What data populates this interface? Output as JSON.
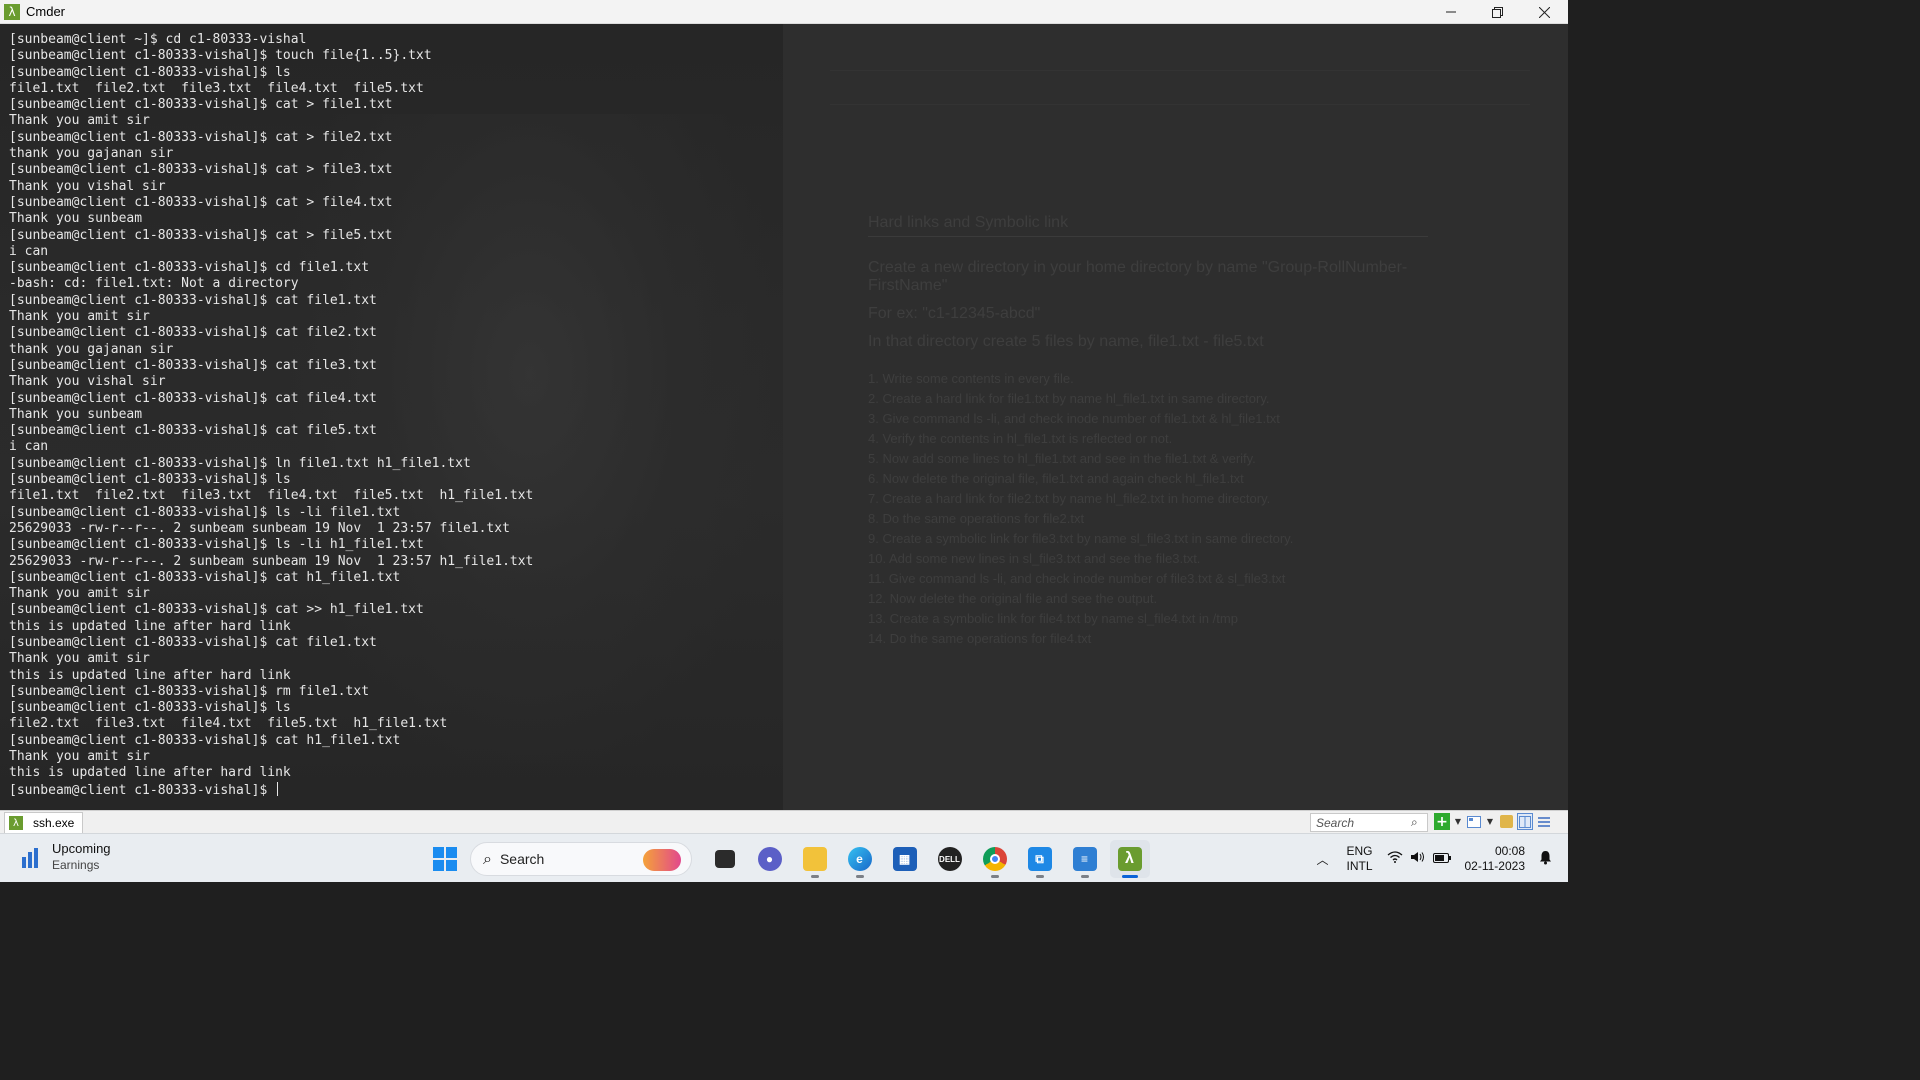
{
  "window": {
    "title": "Cmder",
    "icon": "lambda-icon"
  },
  "terminal": {
    "lines": [
      "[sunbeam@client ~]$ cd c1-80333-vishal",
      "[sunbeam@client c1-80333-vishal]$ touch file{1..5}.txt",
      "[sunbeam@client c1-80333-vishal]$ ls",
      "file1.txt  file2.txt  file3.txt  file4.txt  file5.txt",
      "[sunbeam@client c1-80333-vishal]$ cat > file1.txt",
      "Thank you amit sir",
      "[sunbeam@client c1-80333-vishal]$ cat > file2.txt",
      "thank you gajanan sir",
      "[sunbeam@client c1-80333-vishal]$ cat > file3.txt",
      "Thank you vishal sir",
      "[sunbeam@client c1-80333-vishal]$ cat > file4.txt",
      "Thank you sunbeam",
      "[sunbeam@client c1-80333-vishal]$ cat > file5.txt",
      "i can",
      "[sunbeam@client c1-80333-vishal]$ cd file1.txt",
      "-bash: cd: file1.txt: Not a directory",
      "[sunbeam@client c1-80333-vishal]$ cat file1.txt",
      "Thank you amit sir",
      "[sunbeam@client c1-80333-vishal]$ cat file2.txt",
      "thank you gajanan sir",
      "[sunbeam@client c1-80333-vishal]$ cat file3.txt",
      "Thank you vishal sir",
      "[sunbeam@client c1-80333-vishal]$ cat file4.txt",
      "Thank you sunbeam",
      "[sunbeam@client c1-80333-vishal]$ cat file5.txt",
      "i can",
      "[sunbeam@client c1-80333-vishal]$ ln file1.txt h1_file1.txt",
      "[sunbeam@client c1-80333-vishal]$ ls",
      "file1.txt  file2.txt  file3.txt  file4.txt  file5.txt  h1_file1.txt",
      "[sunbeam@client c1-80333-vishal]$ ls -li file1.txt",
      "25629033 -rw-r--r--. 2 sunbeam sunbeam 19 Nov  1 23:57 file1.txt",
      "[sunbeam@client c1-80333-vishal]$ ls -li h1_file1.txt",
      "25629033 -rw-r--r--. 2 sunbeam sunbeam 19 Nov  1 23:57 h1_file1.txt",
      "[sunbeam@client c1-80333-vishal]$ cat h1_file1.txt",
      "Thank you amit sir",
      "[sunbeam@client c1-80333-vishal]$ cat >> h1_file1.txt",
      "this is updated line after hard link",
      "[sunbeam@client c1-80333-vishal]$ cat file1.txt",
      "Thank you amit sir",
      "this is updated line after hard link",
      "[sunbeam@client c1-80333-vishal]$ rm file1.txt",
      "[sunbeam@client c1-80333-vishal]$ ls",
      "file2.txt  file3.txt  file4.txt  file5.txt  h1_file1.txt",
      "[sunbeam@client c1-80333-vishal]$ cat h1_file1.txt",
      "Thank you amit sir",
      "this is updated line after hard link",
      "[sunbeam@client c1-80333-vishal]$ "
    ]
  },
  "background_doc": {
    "title": "Hard links and Symbolic link",
    "lines": [
      "Create a new directory in your home directory by name \"Group-RollNumber-FirstName\"",
      "For ex: \"c1-12345-abcd\"",
      "In that directory create 5 files by name, file1.txt - file5.txt"
    ],
    "list": [
      "1.  Write some contents in every file.",
      "2.  Create a hard link for file1.txt by name hl_file1.txt in same directory.",
      "3.  Give command ls -li, and check inode number of file1.txt & hl_file1.txt",
      "4.  Verify the contents in hl_file1.txt is reflected or not.",
      "5.  Now add some lines to hl_file1.txt and see in the file1.txt & verify.",
      "6.  Now delete the original file, file1.txt and again check hl_file1.txt",
      "7.  Create a hard link for file2.txt by name hl_file2.txt in home directory.",
      "8.  Do the same operations for file2.txt",
      "9.  Create a symbolic link for file3.txt by name sl_file3.txt in same directory.",
      "10. Add some new lines in sl_file3.txt and see the file3.txt.",
      "11. Give command ls -li, and check inode number of file3.txt & sl_file3.txt",
      "12. Now delete the original file and see the output.",
      "13. Create a symbolic link for file4.txt by name sl_file4.txt in /tmp",
      "14. Do the same operations for file4.txt"
    ]
  },
  "statusbar": {
    "tab_label": "ssh.exe",
    "search_placeholder": "Search"
  },
  "taskbar": {
    "widget_title": "Upcoming",
    "widget_subtitle": "Earnings",
    "search_label": "Search",
    "language_line1": "ENG",
    "language_line2": "INTL",
    "time": "00:08",
    "date": "02-11-2023"
  },
  "colors": {
    "terminal_bg": "#262626",
    "terminal_fg": "#e6e6e6",
    "cmder_green": "#6a9c2f",
    "taskbar_bg": "#e9edf1",
    "accent": "#0a64d8"
  }
}
